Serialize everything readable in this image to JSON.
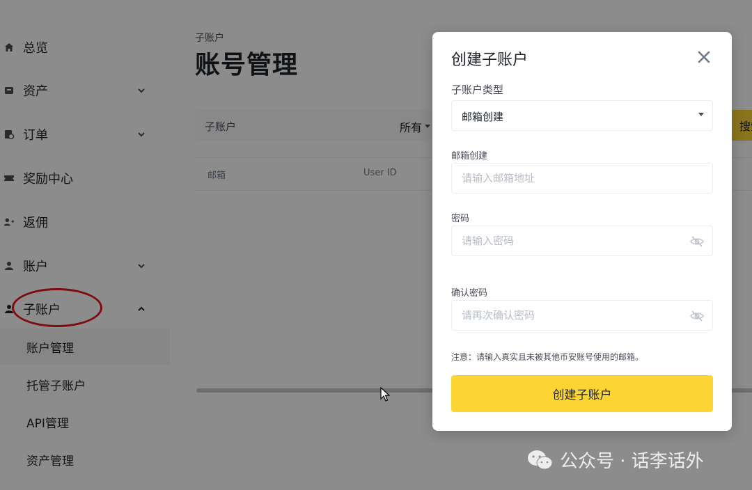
{
  "sidebar": {
    "items": [
      {
        "label": "总览",
        "icon": "home-icon"
      },
      {
        "label": "资产",
        "icon": "wallet-icon"
      },
      {
        "label": "订单",
        "icon": "order-icon"
      },
      {
        "label": "奖励中心",
        "icon": "ticket-icon"
      },
      {
        "label": "返佣",
        "icon": "user-add-icon"
      },
      {
        "label": "账户",
        "icon": "user-icon"
      },
      {
        "label": "子账户",
        "icon": "sub-account-icon"
      }
    ],
    "sub_items": [
      {
        "label": "账户管理",
        "active": true
      },
      {
        "label": "托管子账户"
      },
      {
        "label": "API管理"
      },
      {
        "label": "资产管理"
      }
    ]
  },
  "main": {
    "breadcrumb": "子账户",
    "title": "账号管理",
    "filter": {
      "label": "子账户",
      "select_value": "所有"
    },
    "search_label": "搜索",
    "table": {
      "headers": [
        "邮箱",
        "User ID"
      ]
    }
  },
  "modal": {
    "title": "创建子账户",
    "type_label": "子账户类型",
    "type_value": "邮箱创建",
    "email_label": "邮箱创建",
    "email_placeholder": "请输入邮箱地址",
    "password_label": "密码",
    "password_placeholder": "请输入密码",
    "confirm_label": "确认密码",
    "confirm_placeholder": "请再次确认密码",
    "note": "注意：请输入真实且未被其他币安账号使用的邮箱。",
    "submit_label": "创建子账户"
  },
  "watermark": {
    "text": "公众号 · 话李话外"
  },
  "colors": {
    "accent": "#fcd535",
    "highlight_ring": "#e8141a",
    "text": "#1e2329"
  }
}
